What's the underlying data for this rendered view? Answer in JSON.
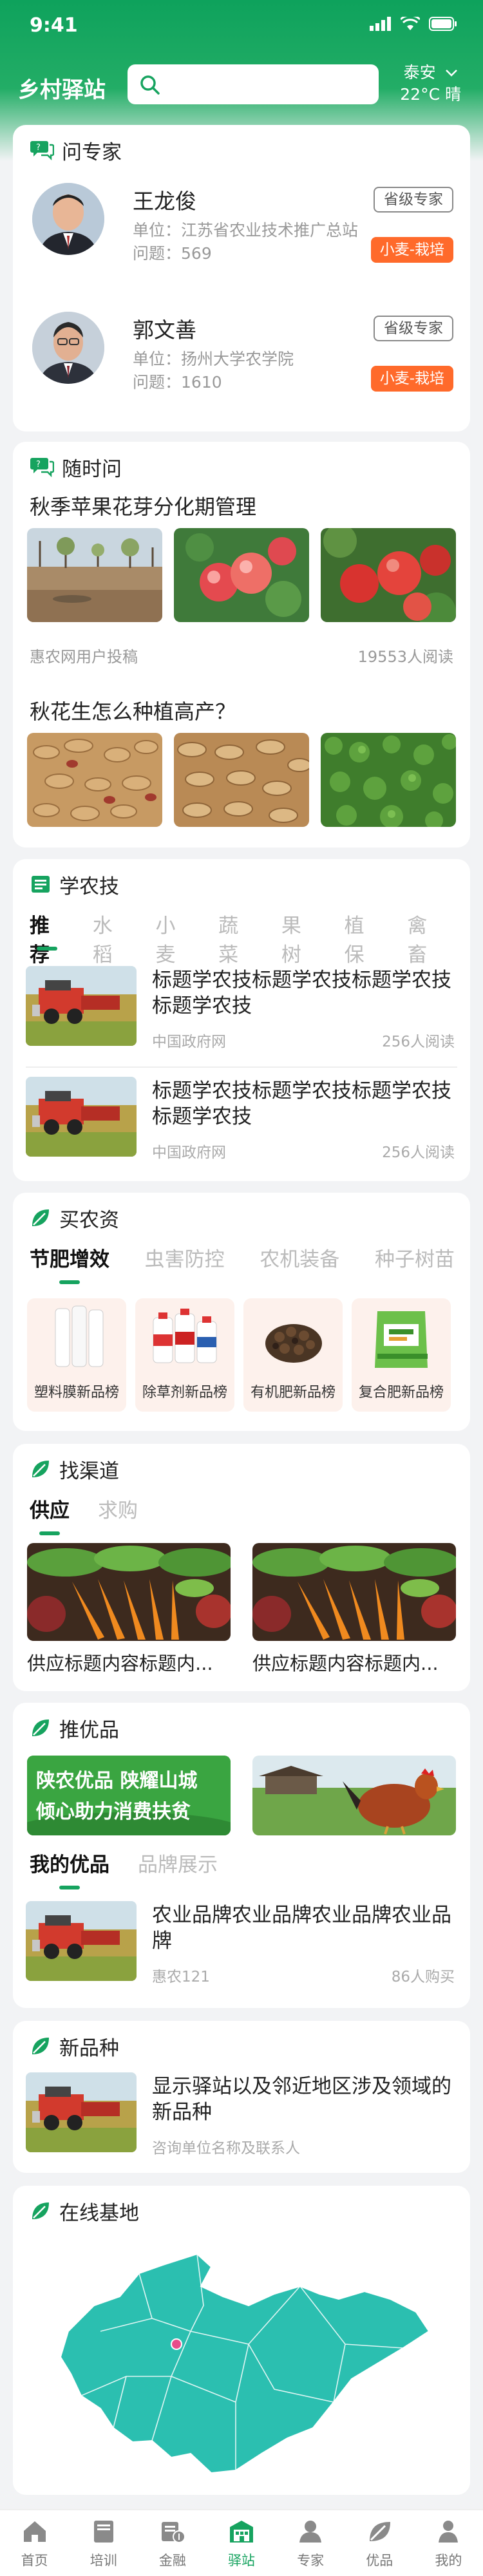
{
  "status": {
    "time": "9:41"
  },
  "header": {
    "brand": "乡村驿站",
    "search_placeholder": "",
    "city": "泰安",
    "weather": "22°C 晴"
  },
  "experts": {
    "title": "问专家",
    "list": [
      {
        "name": "王龙俊",
        "unit_label": "单位：",
        "unit": "江苏省农业技术推广总站",
        "ask_label": "问题：",
        "count": "569",
        "level": "省级专家",
        "tag": "小麦-栽培"
      },
      {
        "name": "郭文善",
        "unit_label": "单位：",
        "unit": "扬州大学农学院",
        "ask_label": "问题：",
        "count": "1610",
        "level": "省级专家",
        "tag": "小麦-栽培"
      }
    ]
  },
  "qa": {
    "title": "随时问",
    "items": [
      {
        "title": "秋季苹果花芽分化期管理",
        "source": "惠农网用户投稿",
        "reads": "19553人阅读"
      },
      {
        "title": "秋花生怎么种植高产？"
      }
    ]
  },
  "learn": {
    "title": "学农技",
    "tabs": [
      "推荐",
      "水稻",
      "小麦",
      "蔬菜",
      "果树",
      "植保",
      "禽畜"
    ],
    "articles": [
      {
        "title": "标题学农技标题学农技标题学农技标题学农技",
        "source": "中国政府网",
        "reads": "256人阅读"
      },
      {
        "title": "标题学农技标题学农技标题学农技标题学农技",
        "source": "中国政府网",
        "reads": "256人阅读"
      }
    ]
  },
  "supplies": {
    "title": "买农资",
    "tabs": [
      "节肥增效",
      "虫害防控",
      "农机装备",
      "种子树苗"
    ],
    "products": [
      "塑料膜新品榜",
      "除草剂新品榜",
      "有机肥新品榜",
      "复合肥新品榜"
    ]
  },
  "channel": {
    "title": "找渠道",
    "tabs": [
      "供应",
      "求购"
    ],
    "items": [
      "供应标题内容标题内...",
      "供应标题内容标题内..."
    ]
  },
  "promo": {
    "title": "推优品",
    "banner_text_1": "陕农优品 陕耀山城",
    "banner_text_2": "倾心助力消费扶贫",
    "tabs": [
      "我的优品",
      "品牌展示"
    ],
    "item": {
      "title": "农业品牌农业品牌农业品牌农业品牌",
      "source": "惠农121",
      "buys": "86人购买"
    }
  },
  "varieties": {
    "title": "新品种",
    "item": {
      "title": "显示驿站以及邻近地区涉及领域的新品种",
      "source": "咨询单位名称及联系人"
    }
  },
  "bases": {
    "title": "在线基地"
  },
  "tabbar": {
    "items": [
      "首页",
      "培训",
      "金融",
      "驿站",
      "专家",
      "优品",
      "我的"
    ],
    "active": "驿站"
  },
  "colors": {
    "brand_green": "#16a35f",
    "tag_orange": "#ff6a2b",
    "map_teal": "#2bbfb0"
  }
}
